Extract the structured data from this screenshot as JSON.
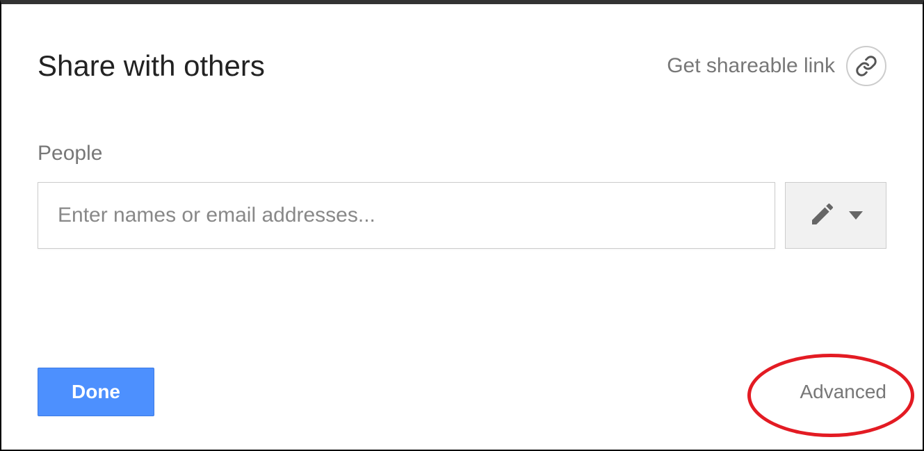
{
  "dialog": {
    "title": "Share with others",
    "shareable_link_label": "Get shareable link",
    "people_label": "People",
    "people_placeholder": "Enter names or email addresses...",
    "done_label": "Done",
    "advanced_label": "Advanced"
  }
}
